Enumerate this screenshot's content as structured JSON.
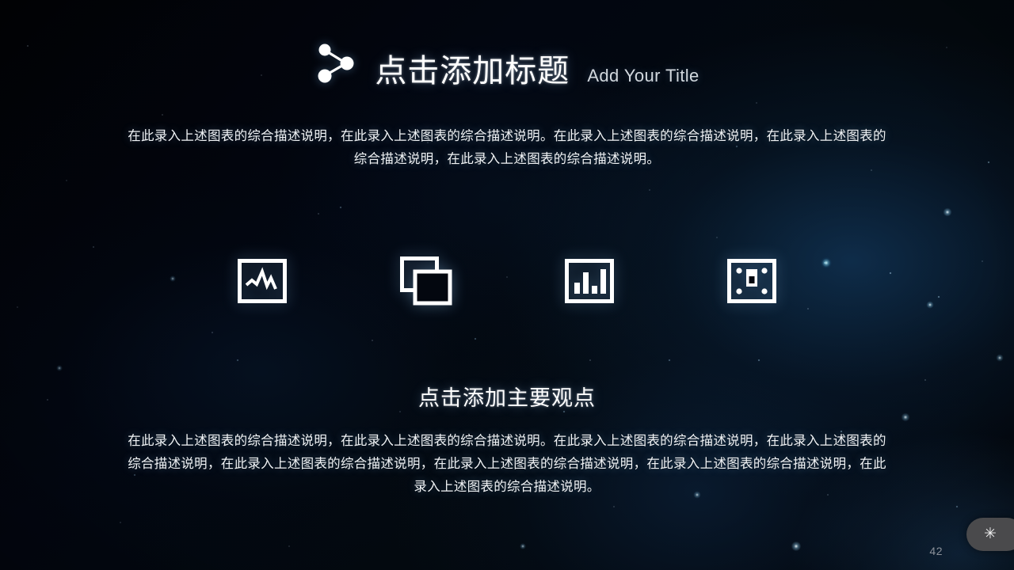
{
  "slide": {
    "background_style": "starfield-space",
    "background_color": "#02040a",
    "accent_glow_color": "#1a4a7a"
  },
  "header": {
    "icon_name": "share-nodes-icon",
    "title_zh": "点击添加标题",
    "title_en": "Add Your Title",
    "title_color": "#ffffff",
    "subtitle_color": "#d2d8de"
  },
  "intro": {
    "paragraph": "在此录入上述图表的综合描述说明，在此录入上述图表的综合描述说明。在此录入上述图表的综合描述说明，在此录入上述图表的综合描述说明，在此录入上述图表的综合描述说明。"
  },
  "features": {
    "items": [
      {
        "icon_name": "line-chart-frame-icon",
        "label": ""
      },
      {
        "icon_name": "copy-layers-icon",
        "label": ""
      },
      {
        "icon_name": "bar-chart-frame-icon",
        "label": ""
      },
      {
        "icon_name": "media-frame-icon",
        "label": ""
      }
    ]
  },
  "section": {
    "heading": "点击添加主要观点",
    "paragraph": "在此录入上述图表的综合描述说明，在此录入上述图表的综合描述说明。在此录入上述图表的综合描述说明，在此录入上述图表的综合描述说明，在此录入上述图表的综合描述说明，在此录入上述图表的综合描述说明，在此录入上述图表的综合描述说明，在此录入上述图表的综合描述说明。"
  },
  "footer": {
    "page_number": "42",
    "badge_glyph": "✳",
    "badge_icon_name": "asterisk-icon",
    "badge_color": "#4a4a4c",
    "page_number_color": "#8b9099"
  }
}
